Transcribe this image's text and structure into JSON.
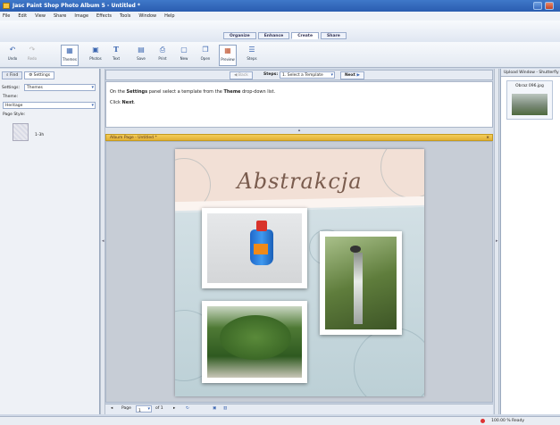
{
  "window": {
    "title": "Jasc Paint Shop Photo Album 5 - Untitled *"
  },
  "menu": [
    "File",
    "Edit",
    "View",
    "Share",
    "Image",
    "Effects",
    "Tools",
    "Window",
    "Help"
  ],
  "workspace_tabs": [
    {
      "label": "Organize",
      "active": false
    },
    {
      "label": "Enhance",
      "active": false
    },
    {
      "label": "Create",
      "active": true
    },
    {
      "label": "Share",
      "active": false
    }
  ],
  "toolbar": {
    "undo": "Undo",
    "redo": "Redo",
    "themes": "Themes",
    "photos": "Photos",
    "text": "Text",
    "save": "Save",
    "print": "Print",
    "new": "New",
    "open": "Open",
    "preview": "Preview",
    "steps": "Steps"
  },
  "left_panel": {
    "tab_find": "Find",
    "tab_settings": "Settings",
    "settings_label": "Settings:",
    "settings_value": "Themes",
    "theme_label": "Theme:",
    "theme_value": "Heritage",
    "page_style_label": "Page Style:",
    "page_style_item": "1-3h"
  },
  "step_bar": {
    "back": "Back",
    "steps_label": "Steps:",
    "steps_value": "1. Select a Template",
    "next": "Next"
  },
  "instructions": {
    "line1_pre": "On the ",
    "line1_b1": "Settings",
    "line1_mid": " panel select a template from the ",
    "line1_b2": "Theme",
    "line1_post": " drop-down list.",
    "line2_pre": "Click ",
    "line2_b": "Next",
    "line2_post": "."
  },
  "album": {
    "header": "Album Page - Untitled *",
    "close": "×",
    "page_title": "Abstrakcja"
  },
  "right_panel": {
    "header": "Upload Window - Shutterfly",
    "item_label": "Obraz 096.jpg"
  },
  "bottom": {
    "page_label": "Page",
    "page_value": "1",
    "of_label": "of 1"
  },
  "status": {
    "text": "100.00 % Ready"
  }
}
